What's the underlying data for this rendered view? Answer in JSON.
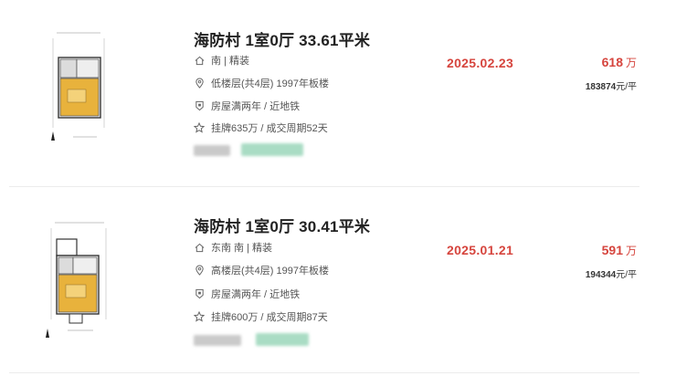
{
  "listings": [
    {
      "title": "海防村 1室0厅 33.61平米",
      "orientation_decoration": "南 | 精装",
      "floor_info": "低楼层(共4层) 1997年板楼",
      "tags": "房屋满两年 / 近地铁",
      "listing_cycle": "挂牌635万 / 成交周期52天",
      "deal_date": "2025.02.23",
      "total_price": "618",
      "total_price_unit": "万",
      "unit_price_value": "183874",
      "unit_price_unit": "元/平"
    },
    {
      "title": "海防村 1室0厅 30.41平米",
      "orientation_decoration": "东南 南 | 精装",
      "floor_info": "高楼层(共4层) 1997年板楼",
      "tags": "房屋满两年 / 近地铁",
      "listing_cycle": "挂牌600万 / 成交周期87天",
      "deal_date": "2025.01.21",
      "total_price": "591",
      "total_price_unit": "万",
      "unit_price_value": "194344",
      "unit_price_unit": "元/平"
    }
  ],
  "icons": {
    "orientation": "house-icon",
    "floor": "location-pin-icon",
    "tags": "shield-icon",
    "listing": "star-icon"
  },
  "colors": {
    "accent": "#d6453e",
    "title": "#222222",
    "text": "#555555"
  }
}
